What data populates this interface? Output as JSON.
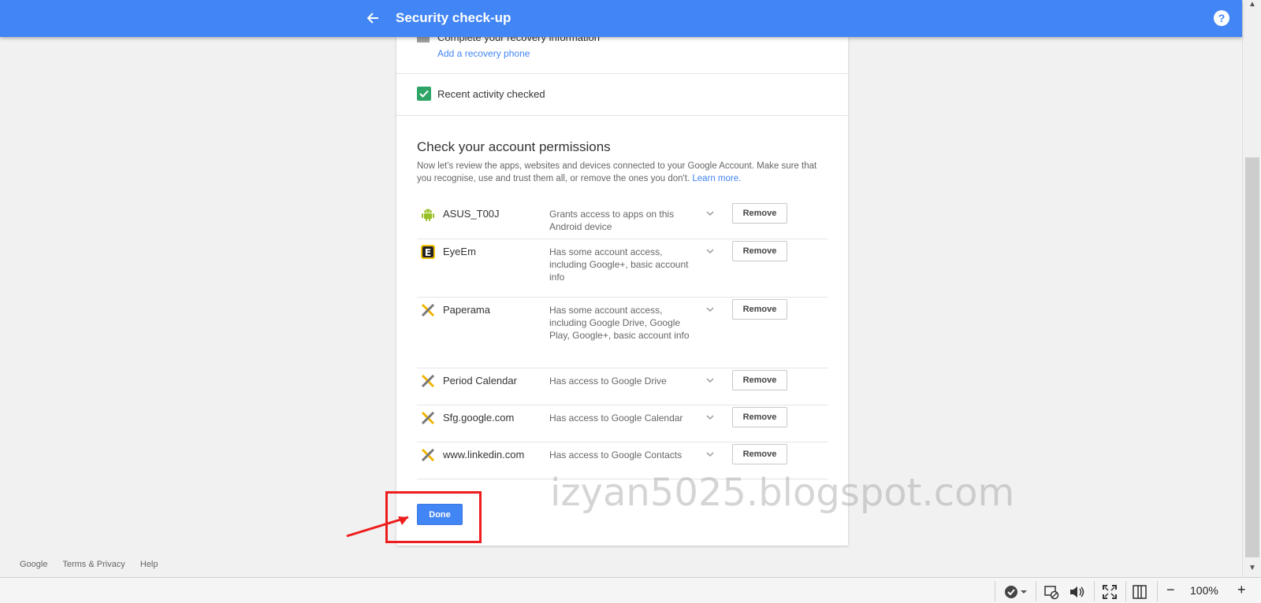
{
  "header": {
    "title": "Security check-up",
    "help_label": "?"
  },
  "recovery": {
    "title": "Complete your recovery information",
    "link": "Add a recovery phone"
  },
  "activity": {
    "label": "Recent activity checked"
  },
  "permissions": {
    "title": "Check your account permissions",
    "description": "Now let's review the apps, websites and devices connected to your Google Account. Make sure that you recognise, use and trust them all, or remove the ones you don't.",
    "learn_more": "Learn more.",
    "remove_label": "Remove",
    "items": [
      {
        "name": "ASUS_T00J",
        "access": "Grants access to apps on this Android device",
        "icon": "android-icon"
      },
      {
        "name": "EyeEm",
        "access": "Has some account access, including Google+, basic account info",
        "icon": "eyeem-icon"
      },
      {
        "name": "Paperama",
        "access": "Has some account access, including Google Drive, Google Play, Google+, basic account info",
        "icon": "app-generic-icon"
      },
      {
        "name": "Period Calendar",
        "access": "Has access to Google Drive",
        "icon": "app-generic-icon"
      },
      {
        "name": "Sfg.google.com",
        "access": "Has access to Google Calendar",
        "icon": "app-generic-icon"
      },
      {
        "name": "www.linkedin.com",
        "access": "Has access to Google Contacts",
        "icon": "app-generic-icon"
      }
    ]
  },
  "done_label": "Done",
  "watermark": "izyan5025.blogspot.com",
  "footer": {
    "google": "Google",
    "terms": "Terms & Privacy",
    "help": "Help"
  },
  "statusbar": {
    "zoom": "100%",
    "zoom_out": "−",
    "zoom_in": "+"
  },
  "colors": {
    "header_bg": "#4285f4",
    "done_bg": "#4285f4",
    "check_green": "#2ea567",
    "annotation_red": "#ee1c1c"
  }
}
